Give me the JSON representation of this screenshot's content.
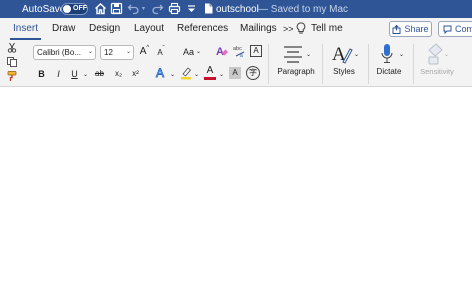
{
  "titlebar": {
    "autosave_label": "AutoSave",
    "autosave_state": "OFF",
    "doc_name": "outschool",
    "doc_status": "— Saved to my Mac"
  },
  "tabs": [
    {
      "label": "Insert",
      "active": true
    },
    {
      "label": "Draw"
    },
    {
      "label": "Design"
    },
    {
      "label": "Layout"
    },
    {
      "label": "References"
    },
    {
      "label": "Mailings"
    }
  ],
  "more_tabs": ">>",
  "tell_me": "Tell me",
  "share": "Share",
  "comments": "Com",
  "font": {
    "name": "Calibri (Bo...",
    "size": "12",
    "increase": "A",
    "decrease": "A",
    "case": "Aa"
  },
  "format": {
    "bold": "B",
    "italic": "I",
    "underline": "U",
    "strike": "ab",
    "subscript": "x₂",
    "superscript": "x²",
    "effects": "A",
    "highlight_color": "#f2d533",
    "font_color": "#c8102e",
    "font_color_letter": "A",
    "shade_letter": "A",
    "phonetic": "字"
  },
  "groups": {
    "paragraph": "Paragraph",
    "styles": "Styles",
    "dictate": "Dictate",
    "sensitivity": "Sensitivity"
  },
  "colors": {
    "titlebar": "#2f5597",
    "accent": "#2f5597",
    "ribbon_bg": "#f3f3f3"
  },
  "icons": [
    "home-icon",
    "save-icon",
    "undo-icon",
    "redo-icon",
    "print-icon",
    "customize-toolbar-icon",
    "document-icon",
    "lightbulb-icon",
    "share-icon",
    "comment-icon",
    "cut-icon",
    "copy-icon",
    "format-painter-icon",
    "clear-formatting-icon",
    "abc-icon",
    "char-border-icon",
    "paragraph-icon",
    "styles-icon",
    "microphone-icon",
    "sensitivity-icon"
  ]
}
